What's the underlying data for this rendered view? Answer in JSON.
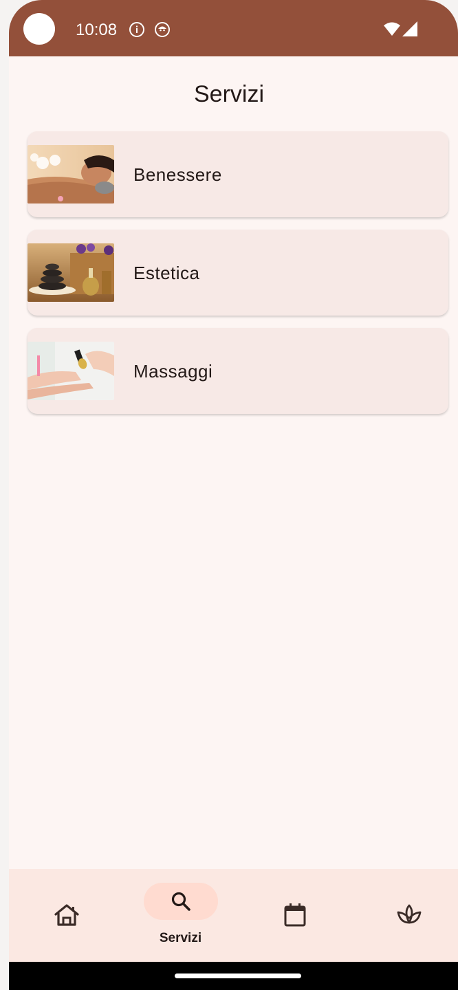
{
  "status_bar": {
    "time": "10:08",
    "icons": [
      "info-icon",
      "notification-icon",
      "wifi-icon",
      "signal-icon"
    ]
  },
  "page": {
    "title": "Servizi"
  },
  "services": [
    {
      "label": "Benessere",
      "image": "spa-back-massage-photo"
    },
    {
      "label": "Estetica",
      "image": "hot-stones-oils-photo"
    },
    {
      "label": "Massaggi",
      "image": "manicure-hands-photo"
    }
  ],
  "bottom_nav": {
    "items": [
      {
        "icon": "home-icon",
        "label": ""
      },
      {
        "icon": "search-icon",
        "label": "Servizi",
        "active": true
      },
      {
        "icon": "calendar-icon",
        "label": ""
      },
      {
        "icon": "lotus-icon",
        "label": ""
      }
    ]
  },
  "colors": {
    "status_bar": "#93503a",
    "background": "#fdf5f3",
    "card": "#f7e9e6",
    "nav_bar": "#fbe8e2",
    "nav_active_pill": "#ffdbd0",
    "text": "#231917"
  }
}
